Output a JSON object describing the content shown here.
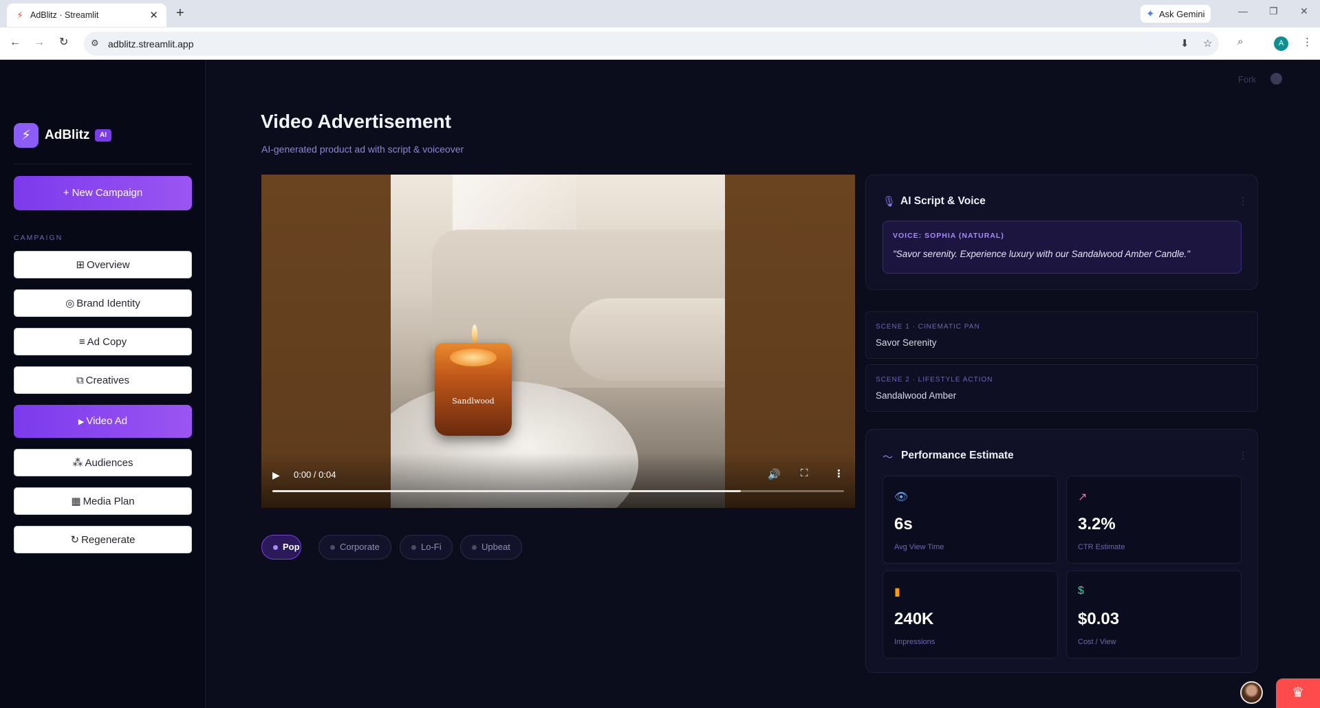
{
  "browser": {
    "tab_title": "AdBlitz · Streamlit",
    "url": "adblitz.streamlit.app",
    "ask_gemini": "Ask Gemini",
    "profile_initial": "A"
  },
  "app": {
    "logo_text": "AdBlitz",
    "ai_badge": "AI",
    "new_campaign": "+ New Campaign",
    "section_label": "CAMPAIGN",
    "nav": [
      {
        "icon": "grid-icon",
        "glyph": "⊞",
        "label": "Overview"
      },
      {
        "icon": "target-icon",
        "glyph": "◎",
        "label": "Brand Identity"
      },
      {
        "icon": "lines-icon",
        "glyph": "≡",
        "label": "Ad Copy"
      },
      {
        "icon": "layers-icon",
        "glyph": "⧉",
        "label": "Creatives"
      },
      {
        "icon": "play-icon",
        "glyph": "▶",
        "label": "Video Ad"
      },
      {
        "icon": "people-icon",
        "glyph": "⁂",
        "label": "Audiences"
      },
      {
        "icon": "calendar-icon",
        "glyph": "▦",
        "label": "Media Plan"
      },
      {
        "icon": "refresh-icon",
        "glyph": "↻",
        "label": "Regenerate"
      }
    ],
    "fork": "Fork"
  },
  "main": {
    "title": "Video Advertisement",
    "subtitle": "AI-generated product ad with script & voiceover",
    "video": {
      "time": "0:00 / 0:04",
      "progress": 0.82,
      "product_label": "Sandlwood"
    },
    "music_chips": [
      {
        "label": "Pop",
        "active": true
      },
      {
        "label": "Corporate",
        "active": false
      },
      {
        "label": "Lo-Fi",
        "active": false
      },
      {
        "label": "Upbeat",
        "active": false
      }
    ]
  },
  "script_panel": {
    "title": "AI Script & Voice",
    "voice_label": "VOICE: SOPHIA (NATURAL)",
    "voice_quote": "\"Savor serenity. Experience luxury with our Sandalwood Amber Candle.\""
  },
  "scenes": [
    {
      "label": "SCENE 1 · CINEMATIC PAN",
      "name": "Savor Serenity"
    },
    {
      "label": "SCENE 2 · LIFESTYLE ACTION",
      "name": "Sandalwood Amber"
    }
  ],
  "performance": {
    "title": "Performance Estimate",
    "metrics": [
      {
        "icon": "eye-icon",
        "value": "6s",
        "label": "Avg View Time",
        "color": "#60a5fa"
      },
      {
        "icon": "trending-up-icon",
        "value": "3.2%",
        "label": "CTR Estimate",
        "color": "#f472b6"
      },
      {
        "icon": "bar-chart-icon",
        "value": "240K",
        "label": "Impressions",
        "color": "#f59e0b"
      },
      {
        "icon": "dollar-icon",
        "value": "$0.03",
        "label": "Cost / View",
        "color": "#34d399"
      }
    ]
  }
}
